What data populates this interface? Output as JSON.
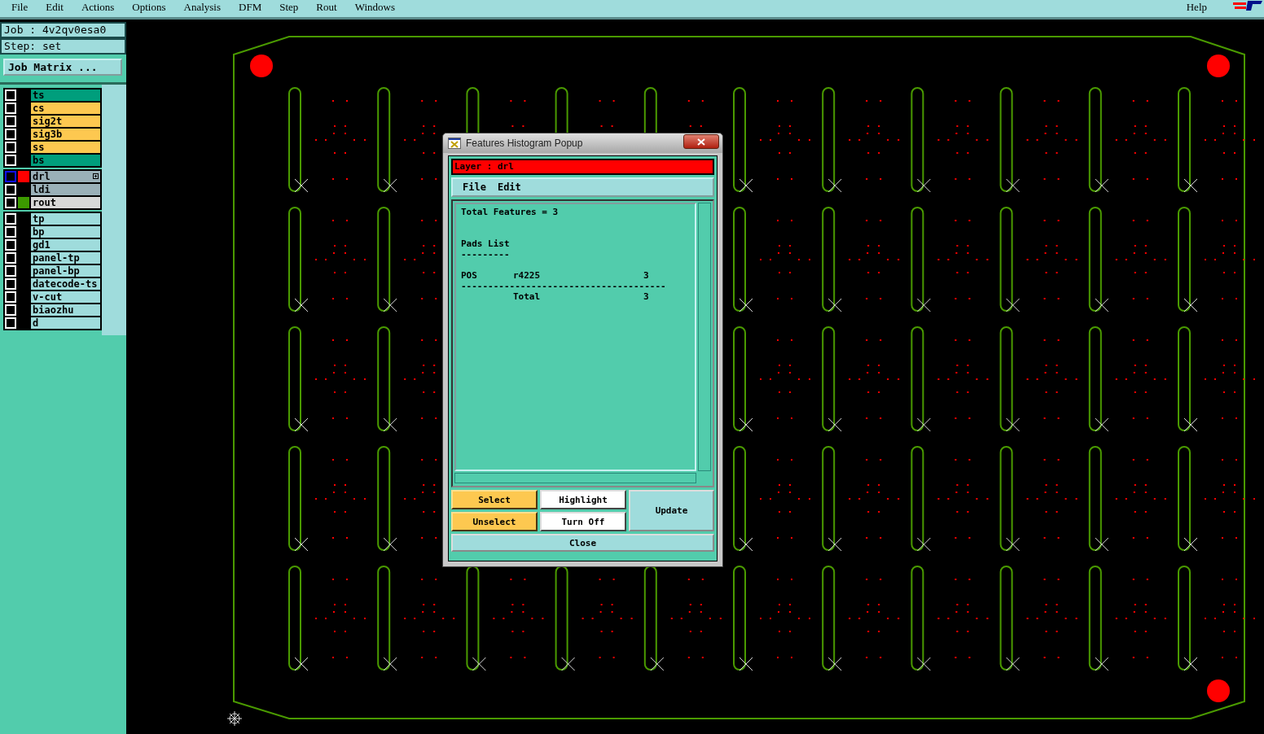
{
  "menu": [
    {
      "label": "File"
    },
    {
      "label": "Edit"
    },
    {
      "label": "Actions"
    },
    {
      "label": "Options"
    },
    {
      "label": "Analysis"
    },
    {
      "label": "DFM"
    },
    {
      "label": "Step"
    },
    {
      "label": "Rout"
    },
    {
      "label": "Windows"
    }
  ],
  "help": "Help",
  "job": "Job : 4v2qv0esa0",
  "step": "Step: set",
  "job_matrix_button": "Job Matrix ...",
  "layer_groups": [
    {
      "layers": [
        {
          "name": "ts",
          "kind": "mask",
          "active": false
        },
        {
          "name": "cs",
          "kind": "signal",
          "active": false
        },
        {
          "name": "sig2t",
          "kind": "signal",
          "active": false
        },
        {
          "name": "sig3b",
          "kind": "signal",
          "active": false
        },
        {
          "name": "ss",
          "kind": "signal",
          "active": false
        },
        {
          "name": "bs",
          "kind": "mask",
          "active": false
        }
      ]
    },
    {
      "layers": [
        {
          "name": "drl",
          "kind": "drill",
          "active": true,
          "color": "#ff0000"
        },
        {
          "name": "ldi",
          "kind": "drill",
          "active": false
        },
        {
          "name": "rout",
          "kind": "rout",
          "active": false,
          "color": "#3c9a00"
        }
      ]
    },
    {
      "layers": [
        {
          "name": "tp",
          "kind": "misc",
          "active": false
        },
        {
          "name": "bp",
          "kind": "misc",
          "active": false
        },
        {
          "name": "gd1",
          "kind": "misc",
          "active": false
        },
        {
          "name": "panel-tp",
          "kind": "misc",
          "active": false
        },
        {
          "name": "panel-bp",
          "kind": "misc",
          "active": false
        },
        {
          "name": "datecode-ts",
          "kind": "misc",
          "active": false
        },
        {
          "name": "v-cut",
          "kind": "misc",
          "active": false
        },
        {
          "name": "biaozhu",
          "kind": "misc",
          "active": false
        },
        {
          "name": "d",
          "kind": "misc",
          "active": false
        }
      ]
    }
  ],
  "popup": {
    "title": "Features Histogram Popup",
    "layer": "Layer :  drl",
    "menu": [
      "File",
      "Edit"
    ],
    "report": {
      "total": "Total Features = 3",
      "section": "Pads List",
      "section_rule": "---------",
      "rows": [
        {
          "type": "POS",
          "size": "r4225",
          "count": "3"
        }
      ],
      "table_rule": "--------------------------------------",
      "total_label": "Total",
      "total_count": "3"
    },
    "buttons": [
      {
        "label": "Select",
        "kind": "orange"
      },
      {
        "label": "Highlight",
        "kind": "white"
      },
      {
        "label": "Unselect",
        "kind": "orange"
      },
      {
        "label": "Turn Off",
        "kind": "white"
      }
    ],
    "update": "Update",
    "close": "Close"
  }
}
